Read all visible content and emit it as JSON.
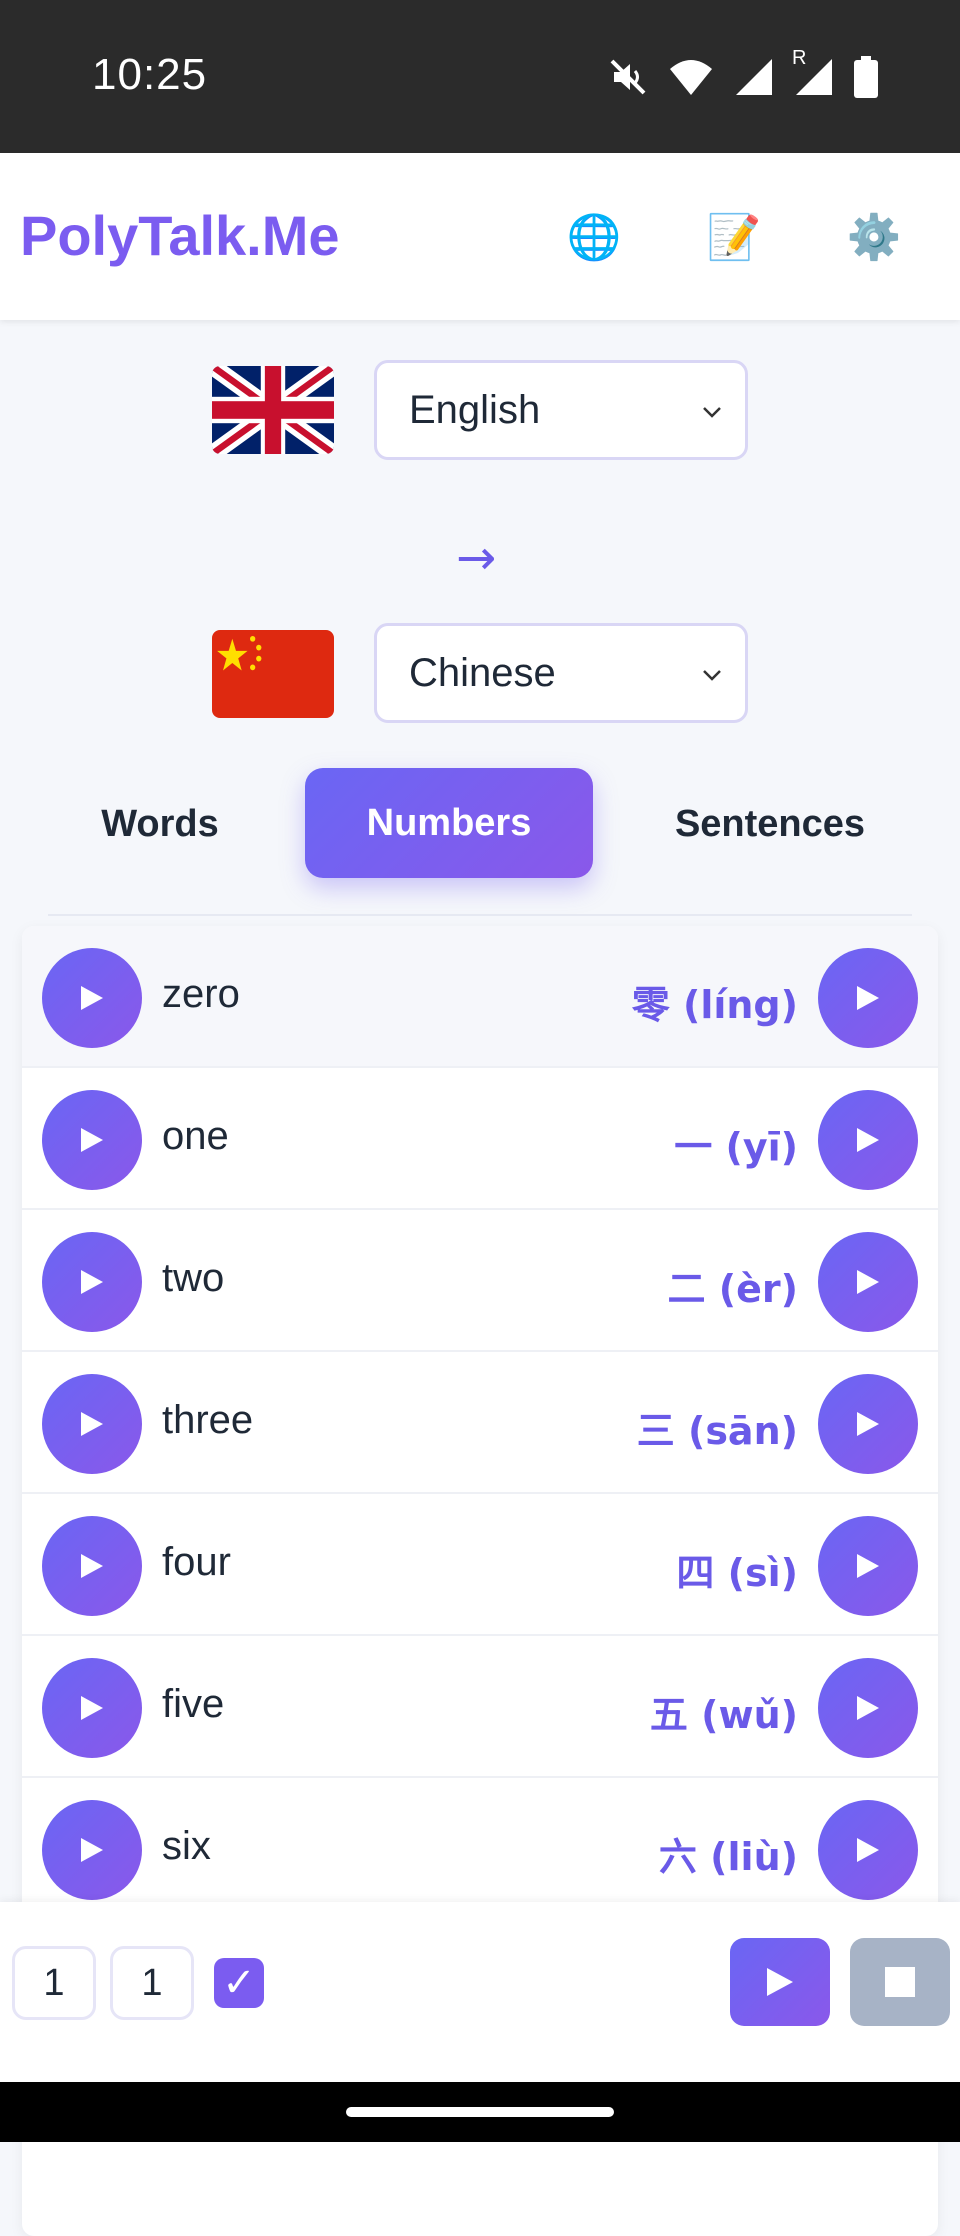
{
  "status_bar": {
    "time": "10:25",
    "icons": [
      "mute-icon",
      "wifi-icon",
      "cell-signal-icon",
      "roaming-signal-icon",
      "battery-icon"
    ],
    "roaming_label": "R"
  },
  "header": {
    "brand": "PolyTalk.Me",
    "buttons": [
      {
        "name": "globe-icon",
        "glyph": "🌐"
      },
      {
        "name": "memo-icon",
        "glyph": "📝"
      },
      {
        "name": "settings-gear-icon",
        "glyph": "⚙️"
      }
    ]
  },
  "languages": {
    "source": {
      "flag": "uk-flag",
      "value": "English"
    },
    "arrow": "→",
    "target": {
      "flag": "china-flag",
      "value": "Chinese"
    }
  },
  "tabs": [
    {
      "label": "Words",
      "active": false
    },
    {
      "label": "Numbers",
      "active": true
    },
    {
      "label": "Sentences",
      "active": false
    }
  ],
  "rows": [
    {
      "word": "zero",
      "translation": "零 (líng)"
    },
    {
      "word": "one",
      "translation": "一 (yī)"
    },
    {
      "word": "two",
      "translation": "二 (èr)"
    },
    {
      "word": "three",
      "translation": "三 (sān)"
    },
    {
      "word": "four",
      "translation": "四 (sì)"
    },
    {
      "word": "five",
      "translation": "五 (wǔ)"
    },
    {
      "word": "six",
      "translation": "六 (liù)"
    }
  ],
  "bottom_bar": {
    "repeat_a": "1",
    "repeat_b": "1",
    "checkbox_checked": true,
    "check_glyph": "✓"
  },
  "colors": {
    "accent": "#7b5cf0",
    "accent_gradient_start": "#6a66f4",
    "accent_gradient_end": "#8a58ea",
    "stop_button": "#a7b3c6"
  }
}
